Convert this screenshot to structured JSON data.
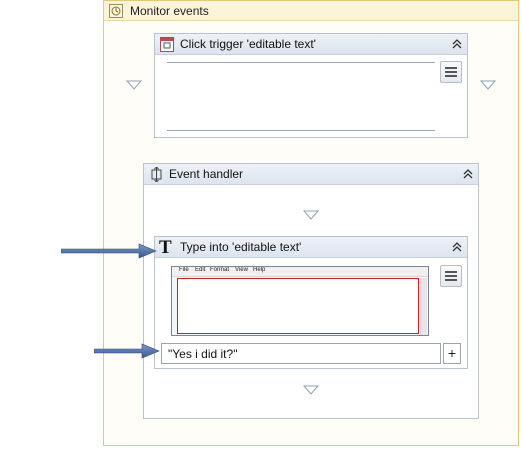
{
  "monitor": {
    "title": "Monitor events",
    "icon": "monitor-events-icon"
  },
  "click_trigger": {
    "title": "Click trigger 'editable text'",
    "icon": "click-trigger-icon"
  },
  "event_handler": {
    "title": "Event handler",
    "icon": "event-handler-icon"
  },
  "type_into": {
    "title": "Type into 'editable text'",
    "icon": "type-into-icon",
    "screenshot_menu": [
      "File",
      "Edit",
      "Format",
      "View",
      "Help"
    ],
    "text_value": "\"Yes i did it?\"",
    "plus_label": "+"
  },
  "colors": {
    "annotation_arrow": "#4f6fa5",
    "selection_outline": "#c8202a",
    "container_border": "#e2c97a"
  }
}
